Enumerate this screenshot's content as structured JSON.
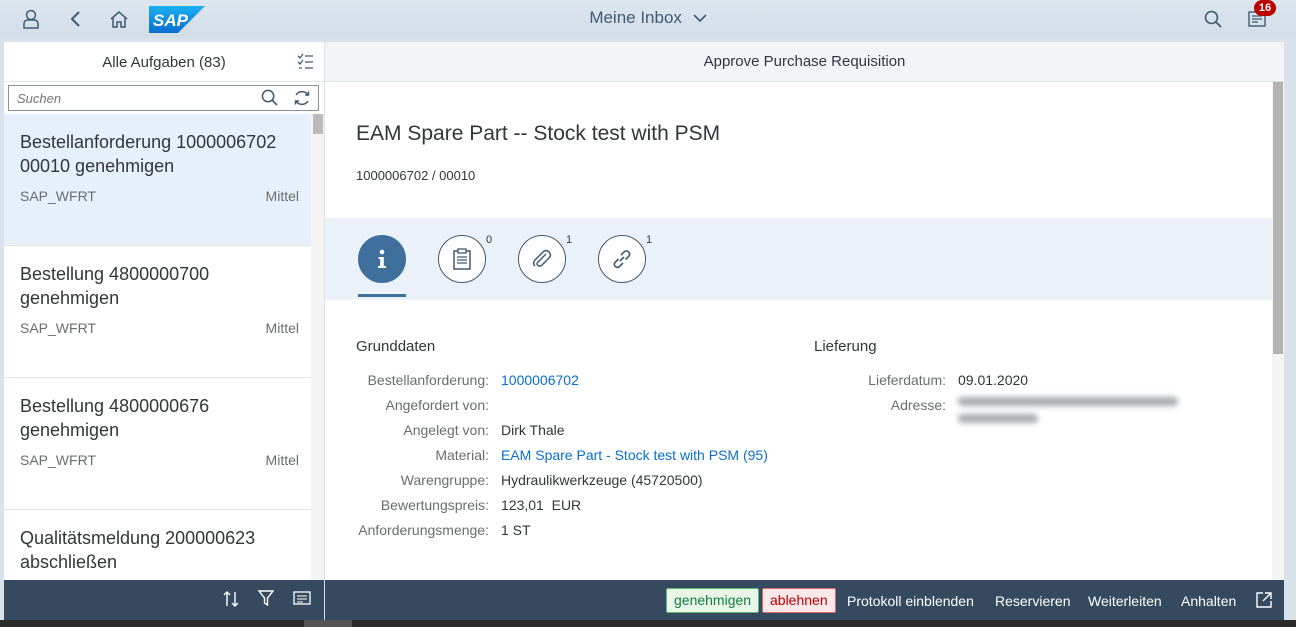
{
  "shell": {
    "title": "Meine Inbox",
    "logo_text": "SAP",
    "notification_count": "16"
  },
  "master": {
    "title": "Alle Aufgaben (83)",
    "search_placeholder": "Suchen",
    "items": [
      {
        "title": "Bestellanforderung 1000006702 00010 genehmigen",
        "user": "SAP_WFRT",
        "priority": "Mittel"
      },
      {
        "title": "Bestellung 4800000700 genehmigen",
        "user": "SAP_WFRT",
        "priority": "Mittel"
      },
      {
        "title": "Bestellung 4800000676 genehmigen",
        "user": "SAP_WFRT",
        "priority": "Mittel"
      },
      {
        "title": "Qualitätsmeldung 200000623 abschließen",
        "user": "",
        "priority": ""
      }
    ]
  },
  "detail": {
    "header": "Approve Purchase Requisition",
    "object_title": "EAM Spare Part -- Stock test with PSM",
    "object_subtitle": "1000006702 / 00010",
    "tabs": [
      {
        "icon": "info-icon",
        "count": ""
      },
      {
        "icon": "notes-icon",
        "count": "0"
      },
      {
        "icon": "attachment-icon",
        "count": "1"
      },
      {
        "icon": "link-icon",
        "count": "1"
      }
    ],
    "grunddaten": {
      "title": "Grunddaten",
      "fields": [
        {
          "label": "Bestellanforderung:",
          "value": "1000006702",
          "link": true
        },
        {
          "label": "Angefordert von:",
          "value": "",
          "link": false
        },
        {
          "label": "Angelegt von:",
          "value": "Dirk Thale",
          "link": false
        },
        {
          "label": "Material:",
          "value": "EAM Spare Part - Stock test with PSM (95)",
          "link": true
        },
        {
          "label": "Warengruppe:",
          "value": "Hydraulikwerkzeuge (45720500)",
          "link": false
        },
        {
          "label": "Bewertungspreis:",
          "value": "123,01  EUR",
          "link": false
        },
        {
          "label": "Anforderungsmenge:",
          "value": "1 ST",
          "link": false
        }
      ]
    },
    "lieferung": {
      "title": "Lieferung",
      "fields": [
        {
          "label": "Lieferdatum:",
          "value": "09.01.2020"
        },
        {
          "label": "Adresse:",
          "value": ""
        }
      ]
    }
  },
  "footer": {
    "approve": "genehmigen",
    "reject": "ablehnen",
    "show_log": "Protokoll einblenden",
    "reserve": "Reservieren",
    "forward": "Weiterleiten",
    "suspend": "Anhalten"
  },
  "colors": {
    "shell_bg": "#d9e2eb",
    "footer_bg": "#354a5f",
    "link": "#0a6ed1",
    "accept": "#107e3e",
    "reject": "#bb0000"
  }
}
